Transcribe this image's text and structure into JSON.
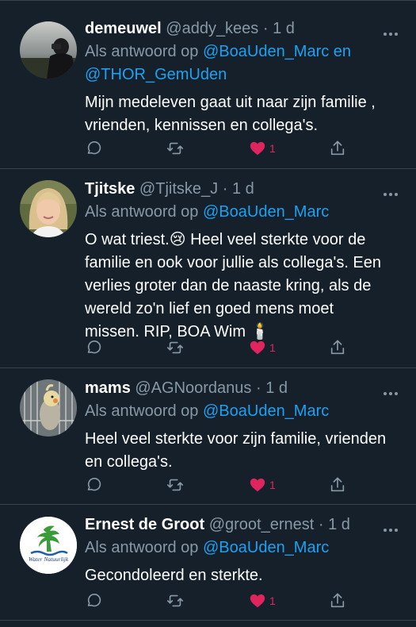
{
  "thread": {
    "tweets": [
      {
        "name": "demeuwel",
        "handle": "@addy_kees",
        "separator": "·",
        "time": "1 d",
        "reply_prefix": "Als antwoord op",
        "mentions_line1": "@BoaUden_Marc en",
        "mentions_line2": "@THOR_GemUden",
        "text_lines": [
          "Mijn medeleven gaat uit naar zijn familie ,",
          "vrienden, kennissen   en collega's."
        ],
        "likes": "1",
        "avatar_icon": "avatar-photo-icon"
      },
      {
        "name": "Tjitske",
        "handle": "@Tjitske_J",
        "separator": "·",
        "time": "1 d",
        "reply_prefix": "Als antwoord op",
        "mentions_line1": "@BoaUden_Marc",
        "text_lines": [
          "O wat triest.😢  Heel veel sterkte voor de",
          "familie en ook voor jullie als collega's. Een",
          "verlies groter dan de naaste kring, als de",
          "wereld zo'n lief en goed mens moet",
          "missen. RIP, BOA Wim 🕯️"
        ],
        "likes": "1",
        "avatar_icon": "avatar-photo-icon"
      },
      {
        "name": "mams",
        "handle": "@AGNoordanus",
        "separator": "·",
        "time": "1 d",
        "reply_prefix": "Als antwoord op",
        "mentions_line1": "@BoaUden_Marc",
        "text_lines": [
          "Heel veel sterkte voor zijn familie, vrienden",
          "en collega's."
        ],
        "likes": "1",
        "avatar_icon": "bird-photo-icon"
      },
      {
        "name": "Ernest de Groot",
        "handle": "@groot_ernest",
        "separator": "·",
        "time": "1 d",
        "reply_prefix": "Als antwoord op",
        "mentions_line1": "@BoaUden_Marc",
        "text_lines": [
          "Gecondoleerd en sterkte."
        ],
        "likes": "1",
        "avatar_icon": "water-natuurlijk-logo-icon",
        "avatar_logo_text": "Water Natuurlijk"
      }
    ]
  },
  "colors": {
    "background": "#15202b",
    "divider": "#38444d",
    "secondary_text": "#8899a6",
    "mention": "#1da1f2",
    "like": "#e0245e"
  }
}
